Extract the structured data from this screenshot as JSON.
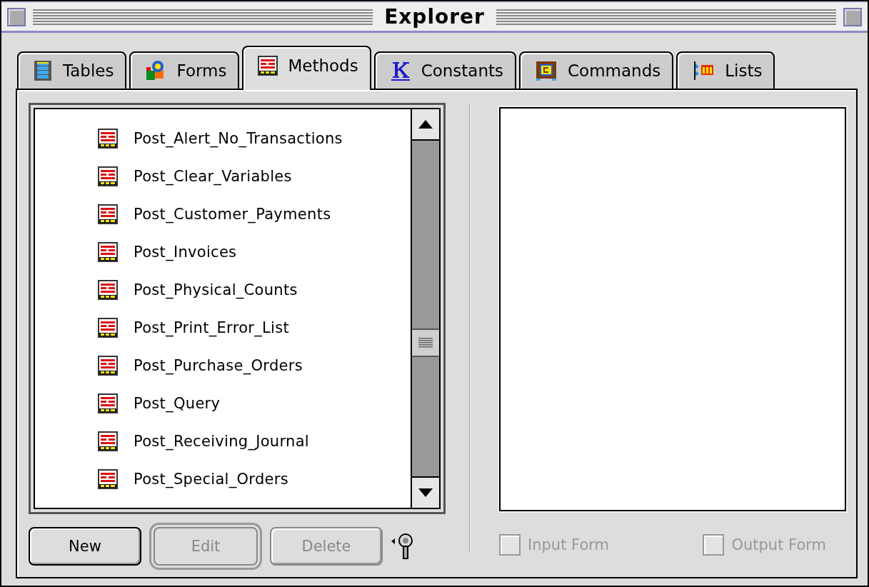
{
  "window": {
    "title": "Explorer"
  },
  "tabs": [
    {
      "label": "Tables",
      "kind": "tables",
      "selected": false
    },
    {
      "label": "Forms",
      "kind": "forms",
      "selected": false
    },
    {
      "label": "Methods",
      "kind": "methods",
      "selected": true
    },
    {
      "label": "Constants",
      "kind": "constants",
      "selected": false
    },
    {
      "label": "Commands",
      "kind": "commands",
      "selected": false
    },
    {
      "label": "Lists",
      "kind": "lists",
      "selected": false
    }
  ],
  "methods": [
    {
      "name": "Post_Alert_No_Transactions"
    },
    {
      "name": "Post_Clear_Variables"
    },
    {
      "name": "Post_Customer_Payments"
    },
    {
      "name": "Post_Invoices"
    },
    {
      "name": "Post_Physical_Counts"
    },
    {
      "name": "Post_Print_Error_List"
    },
    {
      "name": "Post_Purchase_Orders"
    },
    {
      "name": "Post_Query"
    },
    {
      "name": "Post_Receiving_Journal"
    },
    {
      "name": "Post_Special_Orders"
    }
  ],
  "buttons": [
    {
      "label": "New",
      "disabled": false,
      "default": false
    },
    {
      "label": "Edit",
      "disabled": true,
      "default": true
    },
    {
      "label": "Delete",
      "disabled": true,
      "default": false
    }
  ],
  "options": [
    {
      "label": "Input Form",
      "checked": false,
      "disabled": true
    },
    {
      "label": "Output Form",
      "checked": false,
      "disabled": true
    }
  ]
}
